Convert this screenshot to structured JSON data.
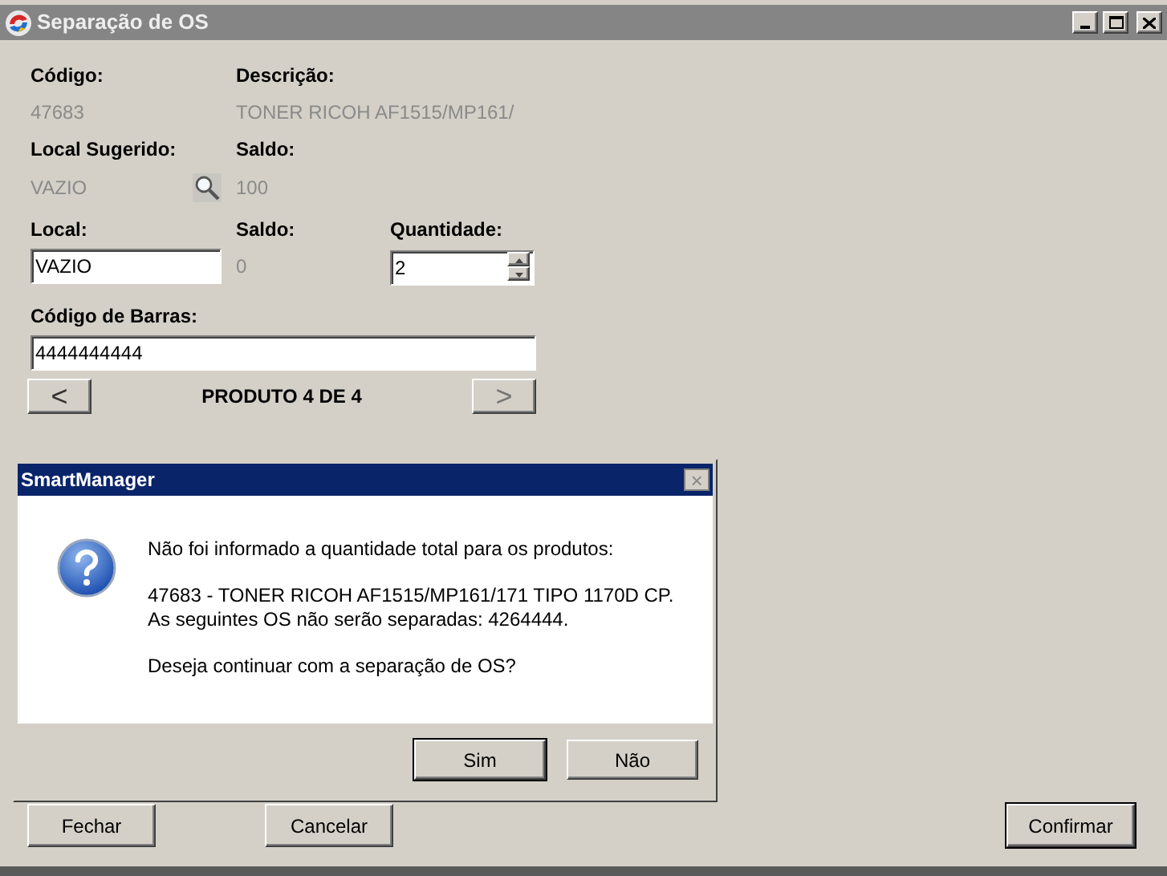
{
  "window": {
    "title": "Separação de OS"
  },
  "fields": {
    "codigo": {
      "label": "Código:",
      "value": "47683"
    },
    "descricao": {
      "label": "Descrição:",
      "value": "TONER RICOH AF1515/MP161/"
    },
    "local_sugerido": {
      "label": "Local Sugerido:",
      "value": "VAZIO"
    },
    "saldo_sugerido": {
      "label": "Saldo:",
      "value": "100"
    },
    "local": {
      "label": "Local:",
      "value": "VAZIO"
    },
    "saldo": {
      "label": "Saldo:",
      "value": "0"
    },
    "quantidade": {
      "label": "Quantidade:",
      "value": "2"
    },
    "codigo_barras": {
      "label": "Código de Barras:",
      "value": "4444444444"
    }
  },
  "navigation": {
    "prev": "<",
    "position": "PRODUTO 4 DE 4",
    "next": ">",
    "next_disabled": true
  },
  "buttons": [
    {
      "label": "Fechar",
      "default": false
    },
    {
      "label": "Cancelar",
      "default": false
    },
    {
      "label": "Confirmar",
      "default": true
    }
  ],
  "dialog": {
    "title": "SmartManager",
    "close": "×",
    "message": [
      "Não foi informado a quantidade total para os produtos:",
      "47683 - TONER RICOH AF1515/MP161/171 TIPO 1170D CP.\nAs seguintes OS não serão separadas: 4264444.",
      "Deseja continuar com a separação de OS?"
    ],
    "buttons": [
      {
        "label": "Sim",
        "default": true
      },
      {
        "label": "Não",
        "default": false
      }
    ]
  }
}
